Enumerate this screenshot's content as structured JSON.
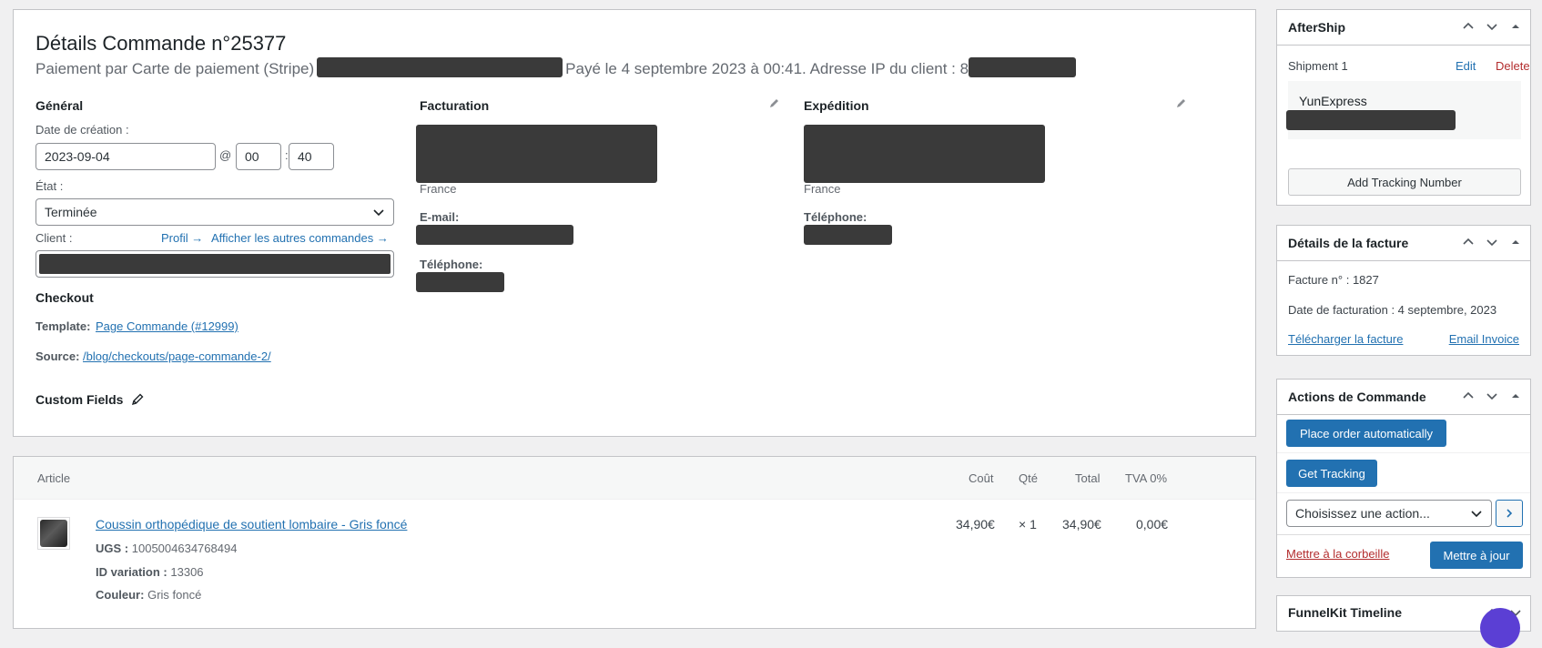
{
  "order": {
    "title": "Détails Commande n°25377",
    "payment_prefix": "Paiement par Carte de paiement (Stripe)",
    "paid_on": "Payé le 4 septembre 2023 à 00:41. Adresse IP du client : 8",
    "general": {
      "heading": "Général",
      "date_label": "Date de création :",
      "date_value": "2023-09-04",
      "at_symbol": "@",
      "hour_value": "00",
      "colon": ":",
      "minute_value": "40",
      "status_label": "État :",
      "status_value": "Terminée",
      "client_label": "Client :",
      "profile_link": "Profil →",
      "other_orders_link": "Afficher les autres commandes →"
    },
    "billing": {
      "heading": "Facturation",
      "country": "France",
      "email_label": "E-mail:",
      "phone_label": "Téléphone:"
    },
    "shipping": {
      "heading": "Expédition",
      "country": "France",
      "phone_label": "Téléphone:"
    },
    "checkout": {
      "heading": "Checkout",
      "template_label": "Template:",
      "template_link": "Page Commande (#12999)",
      "source_label": "Source:",
      "source_link": "/blog/checkouts/page-commande-2/"
    },
    "custom_fields": "Custom Fields"
  },
  "items": {
    "headers": {
      "article": "Article",
      "cost": "Coût",
      "qty": "Qté",
      "total": "Total",
      "tax": "TVA 0%"
    },
    "rows": [
      {
        "name": "Coussin orthopédique de soutient lombaire - Gris foncé",
        "cost": "34,90€",
        "qty": "× 1",
        "total": "34,90€",
        "tax": "0,00€",
        "sku_label": "UGS :",
        "sku": "1005004634768494",
        "variation_label": "ID variation :",
        "variation": "13306",
        "color_label": "Couleur:",
        "color": "Gris foncé"
      }
    ]
  },
  "sidebar": {
    "aftership": {
      "title": "AfterShip",
      "shipment_label": "Shipment 1",
      "edit": "Edit",
      "delete": "Delete",
      "carrier": "YunExpress",
      "add_tracking": "Add Tracking Number"
    },
    "invoice": {
      "title": "Détails de la facture",
      "number": "Facture n° : 1827",
      "date": "Date de facturation : 4 septembre, 2023",
      "download": "Télécharger la facture",
      "email": "Email Invoice"
    },
    "actions": {
      "title": "Actions de Commande",
      "place_order": "Place order automatically",
      "get_tracking": "Get Tracking",
      "select_value": "Choisissez une action...",
      "trash": "Mettre à la corbeille",
      "update": "Mettre à jour"
    },
    "funnelkit": {
      "title": "FunnelKit Timeline"
    }
  },
  "colors": {
    "link": "#2271b1",
    "primary": "#2271b1",
    "delete": "#b32d2e",
    "redaction": "#3a3a3a"
  }
}
